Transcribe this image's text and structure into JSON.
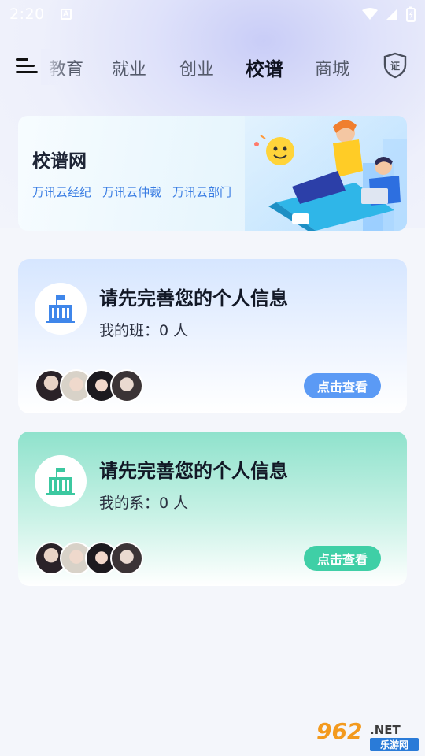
{
  "status_bar": {
    "time": "2:20",
    "notif_icon": "a-notification-icon",
    "wifi_icon": "wifi-icon",
    "signal_icon": "signal-icon",
    "battery_icon": "battery-icon"
  },
  "nav": {
    "tabs": [
      {
        "label": "教育",
        "active": false
      },
      {
        "label": "就业",
        "active": false
      },
      {
        "label": "创业",
        "active": false
      },
      {
        "label": "校谱",
        "active": true
      },
      {
        "label": "商城",
        "active": false
      }
    ],
    "shield_label": "证"
  },
  "banner": {
    "title": "校谱网",
    "links": [
      "万讯云经纪",
      "万讯云仲裁",
      "万讯云部门"
    ]
  },
  "cards": [
    {
      "title": "请先完善您的个人信息",
      "subtitle": "我的班：0 人",
      "button": "点击查看",
      "color": "#5b9af5"
    },
    {
      "title": "请先完善您的个人信息",
      "subtitle": "我的系：0 人",
      "button": "点击查看",
      "color": "#3fcfa6"
    }
  ],
  "watermark": {
    "number": "962",
    "suffix": ".NET",
    "text": "乐游网"
  }
}
